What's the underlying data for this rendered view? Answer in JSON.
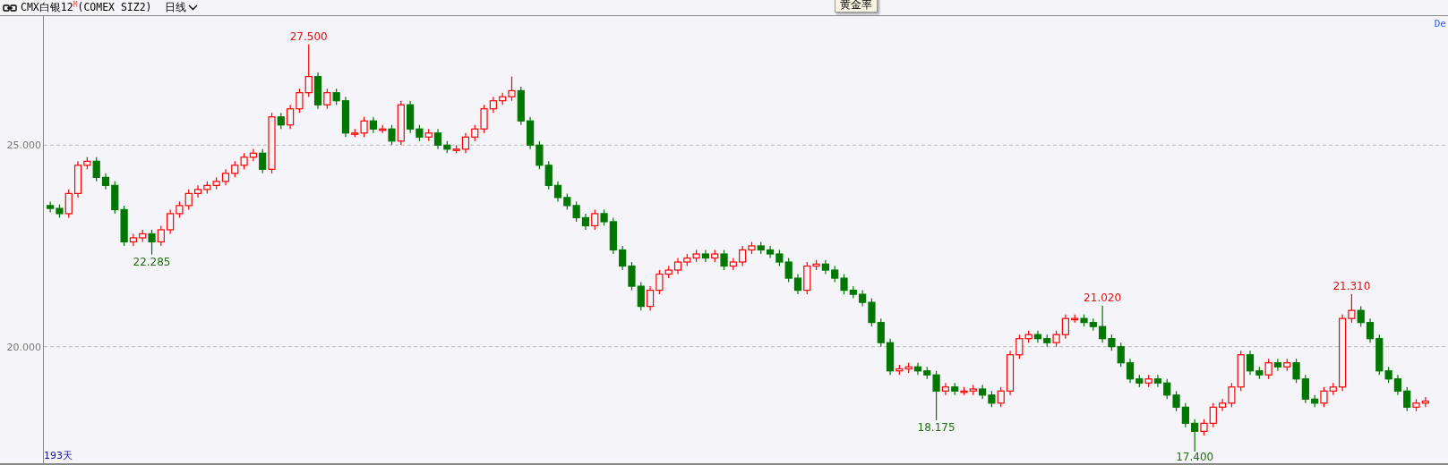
{
  "header": {
    "title": "CMX白银12$^{M}$(COMEX SIZ2)",
    "period": "日线"
  },
  "tooltip": "黄金率",
  "corner_label": "De",
  "day_count": "193天",
  "chart_data": {
    "type": "candlestick",
    "ylim": [
      17.11,
      28.2
    ],
    "yticks": [
      {
        "value": 20,
        "label": "20.000"
      },
      {
        "value": 25,
        "label": "25.000"
      }
    ],
    "ohlc": [
      [
        23.5,
        23.6,
        23.33,
        23.43
      ],
      [
        23.43,
        23.53,
        23.2,
        23.3
      ],
      [
        23.3,
        23.9,
        23.2,
        23.8
      ],
      [
        23.8,
        24.6,
        23.7,
        24.5
      ],
      [
        24.5,
        24.7,
        24.4,
        24.6
      ],
      [
        24.6,
        24.7,
        24.1,
        24.2
      ],
      [
        24.2,
        24.3,
        23.9,
        24.0
      ],
      [
        24.0,
        24.1,
        23.3,
        23.4
      ],
      [
        23.4,
        23.5,
        22.5,
        22.6
      ],
      [
        22.6,
        22.8,
        22.5,
        22.7
      ],
      [
        22.7,
        22.9,
        22.6,
        22.8
      ],
      [
        22.8,
        22.9,
        22.285,
        22.6
      ],
      [
        22.6,
        23.0,
        22.5,
        22.9
      ],
      [
        22.9,
        23.4,
        22.8,
        23.3
      ],
      [
        23.3,
        23.6,
        23.2,
        23.5
      ],
      [
        23.5,
        23.9,
        23.4,
        23.8
      ],
      [
        23.8,
        24.0,
        23.7,
        23.9
      ],
      [
        23.9,
        24.1,
        23.8,
        24.0
      ],
      [
        24.0,
        24.2,
        23.9,
        24.1
      ],
      [
        24.1,
        24.4,
        24.0,
        24.3
      ],
      [
        24.3,
        24.6,
        24.2,
        24.5
      ],
      [
        24.5,
        24.8,
        24.4,
        24.7
      ],
      [
        24.7,
        24.9,
        24.6,
        24.8
      ],
      [
        24.8,
        24.9,
        24.3,
        24.4
      ],
      [
        24.4,
        25.8,
        24.3,
        25.7
      ],
      [
        25.7,
        25.8,
        25.4,
        25.5
      ],
      [
        25.5,
        26.0,
        25.4,
        25.9
      ],
      [
        25.9,
        26.4,
        25.8,
        26.3
      ],
      [
        26.3,
        27.5,
        26.2,
        26.7
      ],
      [
        26.7,
        26.8,
        25.9,
        26.0
      ],
      [
        26.0,
        26.4,
        25.9,
        26.3
      ],
      [
        26.3,
        26.4,
        26.0,
        26.1
      ],
      [
        26.1,
        26.2,
        25.2,
        25.3
      ],
      [
        25.3,
        25.4,
        25.2,
        25.3
      ],
      [
        25.3,
        25.7,
        25.2,
        25.6
      ],
      [
        25.6,
        25.7,
        25.3,
        25.4
      ],
      [
        25.4,
        25.5,
        25.3,
        25.4
      ],
      [
        25.4,
        25.5,
        25.0,
        25.1
      ],
      [
        25.1,
        26.1,
        25.0,
        26.0
      ],
      [
        26.0,
        26.1,
        25.3,
        25.4
      ],
      [
        25.4,
        25.5,
        25.1,
        25.2
      ],
      [
        25.2,
        25.4,
        25.1,
        25.3
      ],
      [
        25.3,
        25.4,
        24.9,
        25.0
      ],
      [
        25.0,
        25.1,
        24.8,
        24.9
      ],
      [
        24.9,
        25.0,
        24.8,
        24.9
      ],
      [
        24.9,
        25.3,
        24.8,
        25.2
      ],
      [
        25.2,
        25.5,
        25.1,
        25.4
      ],
      [
        25.4,
        26.0,
        25.3,
        25.9
      ],
      [
        25.9,
        26.2,
        25.8,
        26.1
      ],
      [
        26.1,
        26.3,
        26.0,
        26.2
      ],
      [
        26.2,
        26.7,
        26.1,
        26.35
      ],
      [
        26.35,
        26.45,
        25.5,
        25.6
      ],
      [
        25.6,
        25.7,
        24.9,
        25.0
      ],
      [
        25.0,
        25.1,
        24.4,
        24.5
      ],
      [
        24.5,
        24.6,
        23.9,
        24.0
      ],
      [
        24.0,
        24.1,
        23.6,
        23.7
      ],
      [
        23.7,
        23.8,
        23.4,
        23.5
      ],
      [
        23.5,
        23.6,
        23.1,
        23.2
      ],
      [
        23.2,
        23.3,
        22.9,
        23.0
      ],
      [
        23.0,
        23.4,
        22.9,
        23.3
      ],
      [
        23.3,
        23.4,
        23.0,
        23.1
      ],
      [
        23.1,
        23.2,
        22.3,
        22.4
      ],
      [
        22.4,
        22.5,
        21.9,
        22.0
      ],
      [
        22.0,
        22.1,
        21.4,
        21.5
      ],
      [
        21.5,
        21.6,
        20.9,
        21.0
      ],
      [
        21.0,
        21.5,
        20.9,
        21.4
      ],
      [
        21.4,
        21.9,
        21.3,
        21.8
      ],
      [
        21.8,
        22.0,
        21.7,
        21.9
      ],
      [
        21.9,
        22.2,
        21.8,
        22.1
      ],
      [
        22.1,
        22.3,
        22.0,
        22.2
      ],
      [
        22.2,
        22.4,
        22.1,
        22.3
      ],
      [
        22.3,
        22.4,
        22.1,
        22.2
      ],
      [
        22.2,
        22.4,
        22.1,
        22.3
      ],
      [
        22.3,
        22.4,
        21.9,
        22.0
      ],
      [
        22.0,
        22.2,
        21.9,
        22.1
      ],
      [
        22.1,
        22.5,
        22.0,
        22.4
      ],
      [
        22.4,
        22.6,
        22.3,
        22.5
      ],
      [
        22.5,
        22.6,
        22.3,
        22.4
      ],
      [
        22.4,
        22.5,
        22.2,
        22.3
      ],
      [
        22.3,
        22.4,
        22.0,
        22.1
      ],
      [
        22.1,
        22.2,
        21.6,
        21.7
      ],
      [
        21.7,
        21.8,
        21.3,
        21.4
      ],
      [
        21.4,
        22.1,
        21.3,
        22.0
      ],
      [
        22.0,
        22.15,
        21.9,
        22.05
      ],
      [
        22.05,
        22.15,
        21.8,
        21.9
      ],
      [
        21.9,
        22.0,
        21.6,
        21.7
      ],
      [
        21.7,
        21.8,
        21.3,
        21.4
      ],
      [
        21.4,
        21.5,
        21.2,
        21.3
      ],
      [
        21.3,
        21.4,
        21.0,
        21.1
      ],
      [
        21.1,
        21.2,
        20.5,
        20.6
      ],
      [
        20.6,
        20.7,
        20.0,
        20.1
      ],
      [
        20.1,
        20.2,
        19.3,
        19.4
      ],
      [
        19.4,
        19.55,
        19.3,
        19.45
      ],
      [
        19.45,
        19.6,
        19.35,
        19.5
      ],
      [
        19.5,
        19.6,
        19.3,
        19.4
      ],
      [
        19.4,
        19.5,
        19.2,
        19.3
      ],
      [
        19.3,
        19.4,
        18.175,
        18.9
      ],
      [
        18.9,
        19.1,
        18.8,
        19.0
      ],
      [
        19.0,
        19.1,
        18.8,
        18.9
      ],
      [
        18.9,
        19.0,
        18.8,
        18.9
      ],
      [
        18.9,
        19.05,
        18.8,
        18.95
      ],
      [
        18.95,
        19.05,
        18.7,
        18.8
      ],
      [
        18.8,
        18.9,
        18.5,
        18.6
      ],
      [
        18.6,
        19.0,
        18.5,
        18.9
      ],
      [
        18.9,
        19.9,
        18.8,
        19.8
      ],
      [
        19.8,
        20.3,
        19.7,
        20.2
      ],
      [
        20.2,
        20.4,
        20.1,
        20.3
      ],
      [
        20.3,
        20.4,
        20.1,
        20.2
      ],
      [
        20.2,
        20.3,
        20.0,
        20.1
      ],
      [
        20.1,
        20.4,
        20.0,
        20.3
      ],
      [
        20.3,
        20.8,
        20.2,
        20.7
      ],
      [
        20.7,
        20.8,
        20.6,
        20.7
      ],
      [
        20.7,
        20.8,
        20.5,
        20.6
      ],
      [
        20.6,
        20.7,
        20.4,
        20.5
      ],
      [
        20.5,
        21.02,
        20.1,
        20.2
      ],
      [
        20.2,
        20.3,
        19.9,
        20.0
      ],
      [
        20.0,
        20.1,
        19.5,
        19.6
      ],
      [
        19.6,
        19.7,
        19.1,
        19.2
      ],
      [
        19.2,
        19.3,
        19.0,
        19.1
      ],
      [
        19.1,
        19.3,
        19.0,
        19.2
      ],
      [
        19.2,
        19.3,
        19.0,
        19.1
      ],
      [
        19.1,
        19.2,
        18.7,
        18.8
      ],
      [
        18.8,
        18.9,
        18.4,
        18.5
      ],
      [
        18.5,
        18.6,
        18.0,
        18.1
      ],
      [
        18.1,
        18.2,
        17.4,
        17.9
      ],
      [
        17.9,
        18.2,
        17.8,
        18.1
      ],
      [
        18.1,
        18.6,
        18.0,
        18.5
      ],
      [
        18.5,
        18.7,
        18.4,
        18.6
      ],
      [
        18.6,
        19.1,
        18.5,
        19.0
      ],
      [
        19.0,
        19.9,
        18.9,
        19.8
      ],
      [
        19.8,
        19.9,
        19.3,
        19.4
      ],
      [
        19.4,
        19.5,
        19.2,
        19.3
      ],
      [
        19.3,
        19.7,
        19.2,
        19.6
      ],
      [
        19.6,
        19.7,
        19.4,
        19.5
      ],
      [
        19.5,
        19.7,
        19.4,
        19.6
      ],
      [
        19.6,
        19.7,
        19.1,
        19.2
      ],
      [
        19.2,
        19.3,
        18.6,
        18.7
      ],
      [
        18.7,
        18.8,
        18.5,
        18.6
      ],
      [
        18.6,
        19.0,
        18.5,
        18.9
      ],
      [
        18.9,
        19.1,
        18.8,
        19.0
      ],
      [
        19.0,
        20.8,
        18.9,
        20.7
      ],
      [
        20.7,
        21.31,
        20.6,
        20.9
      ],
      [
        20.9,
        21.0,
        20.5,
        20.6
      ],
      [
        20.6,
        20.7,
        20.1,
        20.2
      ],
      [
        20.2,
        20.3,
        19.3,
        19.4
      ],
      [
        19.4,
        19.5,
        19.1,
        19.2
      ],
      [
        19.2,
        19.3,
        18.8,
        18.9
      ],
      [
        18.9,
        19.0,
        18.4,
        18.5
      ],
      [
        18.5,
        18.7,
        18.4,
        18.6
      ],
      [
        18.6,
        18.75,
        18.5,
        18.65
      ]
    ],
    "annotations": [
      "27.500",
      "22.285",
      "18.175",
      "21.020",
      "17.400",
      "21.310"
    ]
  }
}
